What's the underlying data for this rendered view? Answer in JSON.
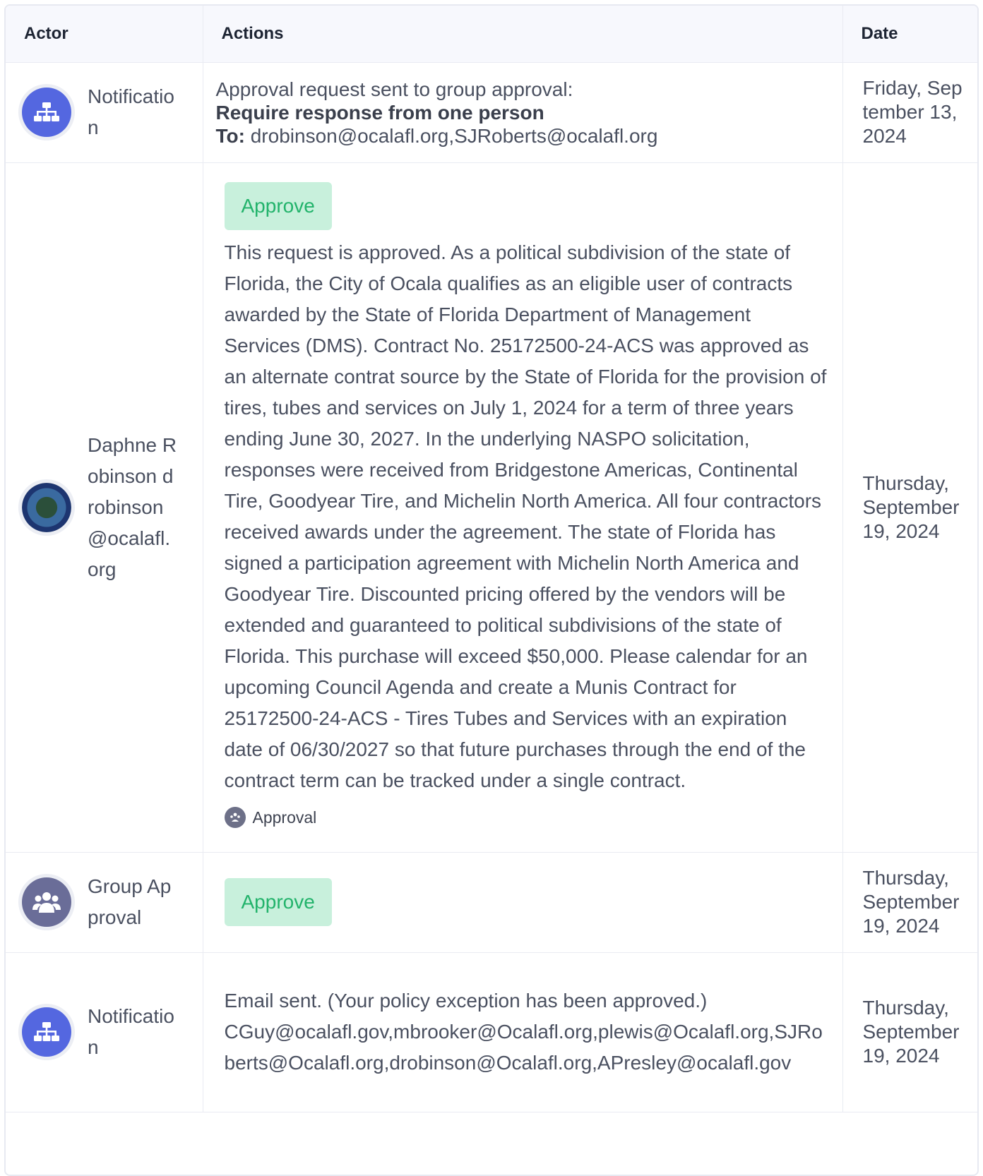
{
  "table": {
    "headers": {
      "actor": "Actor",
      "actions": "Actions",
      "date": "Date"
    },
    "rows": [
      {
        "actor": {
          "name": "Notificatio n",
          "icon": "sitemap-icon"
        },
        "actions": {
          "line1": "Approval request sent to group approval:",
          "line2": "Require response from one person",
          "to_label": "To:",
          "to_value": " drobinson@ocalafl.org,SJRoberts@ocalafl.org"
        },
        "date": "Friday, September 13, 2024"
      },
      {
        "actor": {
          "name": "Daphne Robinson drobinson @ocalafl. org",
          "icon": "city-seal-avatar"
        },
        "actions": {
          "button": "Approve",
          "comment": "This request is approved.  As a political subdivision of the state of Florida, the City of Ocala qualifies as an eligible user of contracts awarded by the State of Florida Department of Management Services (DMS).  Contract No. 25172500-24-ACS was approved as an alternate contrat source by the State of Florida for the provision of tires, tubes and services on July 1, 2024 for a term of three years ending June 30, 2027.   In the underlying NASPO solicitation, responses were received from Bridgestone Americas, Continental Tire, Goodyear Tire, and Michelin North America.  All four contractors received awards under the agreement.  The state of Florida has signed a participation agreement with Michelin North America and Goodyear Tire.  Discounted pricing offered by the vendors will be extended and guaranteed to political subdivisions of the state of Florida.   This purchase will exceed $50,000.  Please calendar for an upcoming Council Agenda and create a Munis Contract for 25172500-24-ACS - Tires Tubes and Services with an expiration date of 06/30/2027 so that future purchases through the end of the contract term can be tracked under a single contract.",
          "tag": "Approval"
        },
        "date": "Thursday, September 19, 2024"
      },
      {
        "actor": {
          "name": "Group Approval",
          "icon": "users-group-icon"
        },
        "actions": {
          "button": "Approve"
        },
        "date": "Thursday, September 19, 2024"
      },
      {
        "actor": {
          "name": "Notificatio n",
          "icon": "sitemap-icon"
        },
        "actions": {
          "line1": "Email sent. (Your policy exception has been approved.)",
          "line2": "CGuy@ocalafl.gov,mbrooker@Ocalafl.org,plewis@Ocalafl.org,SJRoberts@Ocalafl.org,drobinson@Ocalafl.org,APresley@ocalafl.gov"
        },
        "date": "Thursday, September 19, 2024"
      }
    ]
  },
  "colors": {
    "approve_bg": "#c8f0dc",
    "approve_text": "#22b36b",
    "avatar_blue": "#5467e0",
    "avatar_slate": "#6a6d98",
    "header_bg": "#f7f8fd"
  }
}
